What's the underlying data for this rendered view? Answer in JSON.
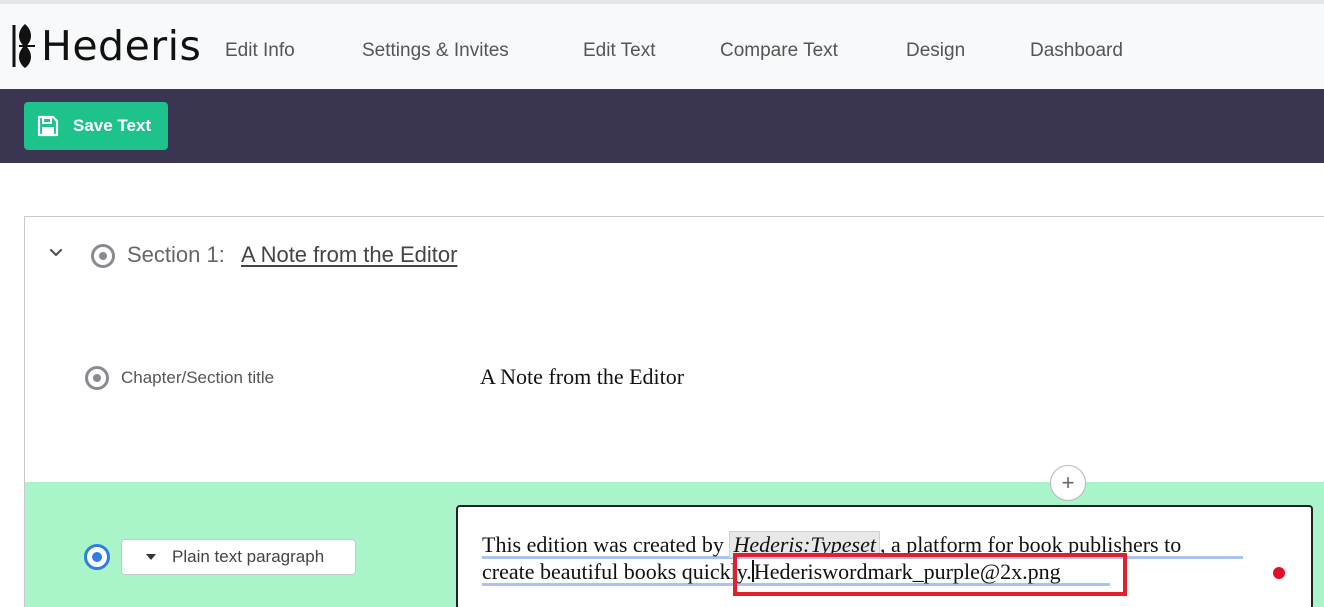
{
  "app": {
    "logo_text": "Hederis"
  },
  "nav": {
    "items": [
      "Edit Info",
      "Settings & Invites",
      "Edit Text",
      "Compare Text",
      "Design",
      "Dashboard"
    ]
  },
  "toolbar": {
    "save_label": "Save Text",
    "save_icon": "floppy-disk-icon"
  },
  "section": {
    "label": "Section 1:",
    "title": "A Note from the Editor"
  },
  "rows": {
    "chapter": {
      "label": "Chapter/Section title",
      "value": "A Note from the Editor"
    },
    "paragraph": {
      "type_label": "Plain text paragraph",
      "add_label": "+",
      "line1_before": "This edition was created by",
      "line1_tag": "Hederis:Typeset",
      "line1_after": ", a platform for book publishers to",
      "line2_before": "create beautiful books quickly.",
      "line2_after": "Hederiswordmark_purple@2x.png"
    }
  },
  "colors": {
    "toolbar_bg": "#3a3652",
    "save_button": "#1ec28b",
    "active_row": "#a9f5c9",
    "highlight_box": "#e0202a"
  }
}
